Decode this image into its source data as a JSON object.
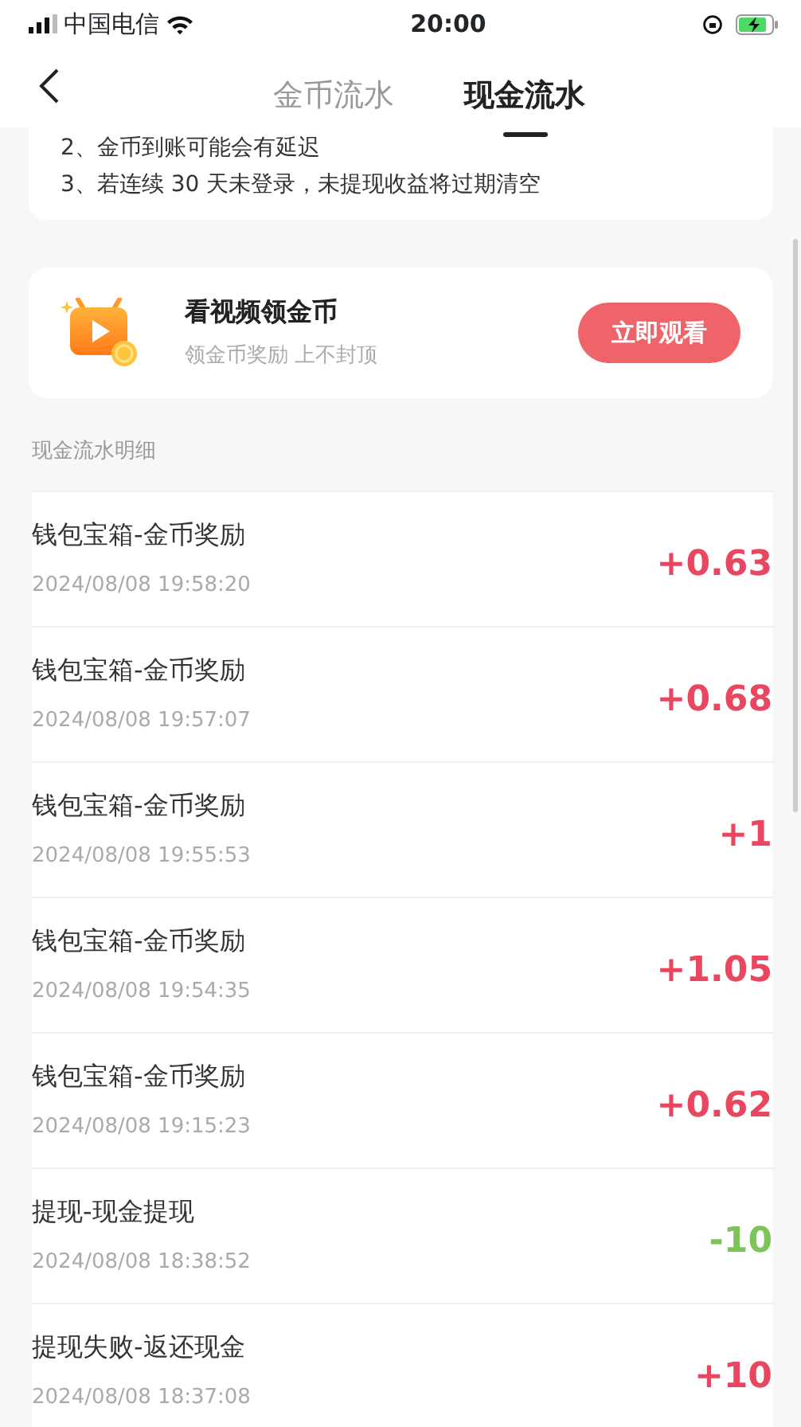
{
  "status_bar": {
    "carrier": "中国电信",
    "time": "20:00"
  },
  "tabs": [
    {
      "label": "金币流水",
      "selected": false
    },
    {
      "label": "现金流水",
      "selected": true
    }
  ],
  "notice": {
    "lines": [
      "2、金币到账可能会有延迟",
      "3、若连续 30 天未登录，未提现收益将过期清空"
    ]
  },
  "promo": {
    "title": "看视频领金币",
    "subtitle": "领金币奖励 上不封顶",
    "button": "立即观看"
  },
  "section_title": "现金流水明细",
  "records": [
    {
      "title": "钱包宝箱-金币奖励",
      "time": "2024/08/08 19:58:20",
      "amount": "+0.63",
      "kind": "income"
    },
    {
      "title": "钱包宝箱-金币奖励",
      "time": "2024/08/08 19:57:07",
      "amount": "+0.68",
      "kind": "income"
    },
    {
      "title": "钱包宝箱-金币奖励",
      "time": "2024/08/08 19:55:53",
      "amount": "+1",
      "kind": "income"
    },
    {
      "title": "钱包宝箱-金币奖励",
      "time": "2024/08/08 19:54:35",
      "amount": "+1.05",
      "kind": "income"
    },
    {
      "title": "钱包宝箱-金币奖励",
      "time": "2024/08/08 19:15:23",
      "amount": "+0.62",
      "kind": "income"
    },
    {
      "title": "提现-现金提现",
      "time": "2024/08/08 18:38:52",
      "amount": "-10",
      "kind": "expense"
    },
    {
      "title": "提现失败-返还现金",
      "time": "2024/08/08 18:37:08",
      "amount": "+10",
      "kind": "income"
    }
  ]
}
